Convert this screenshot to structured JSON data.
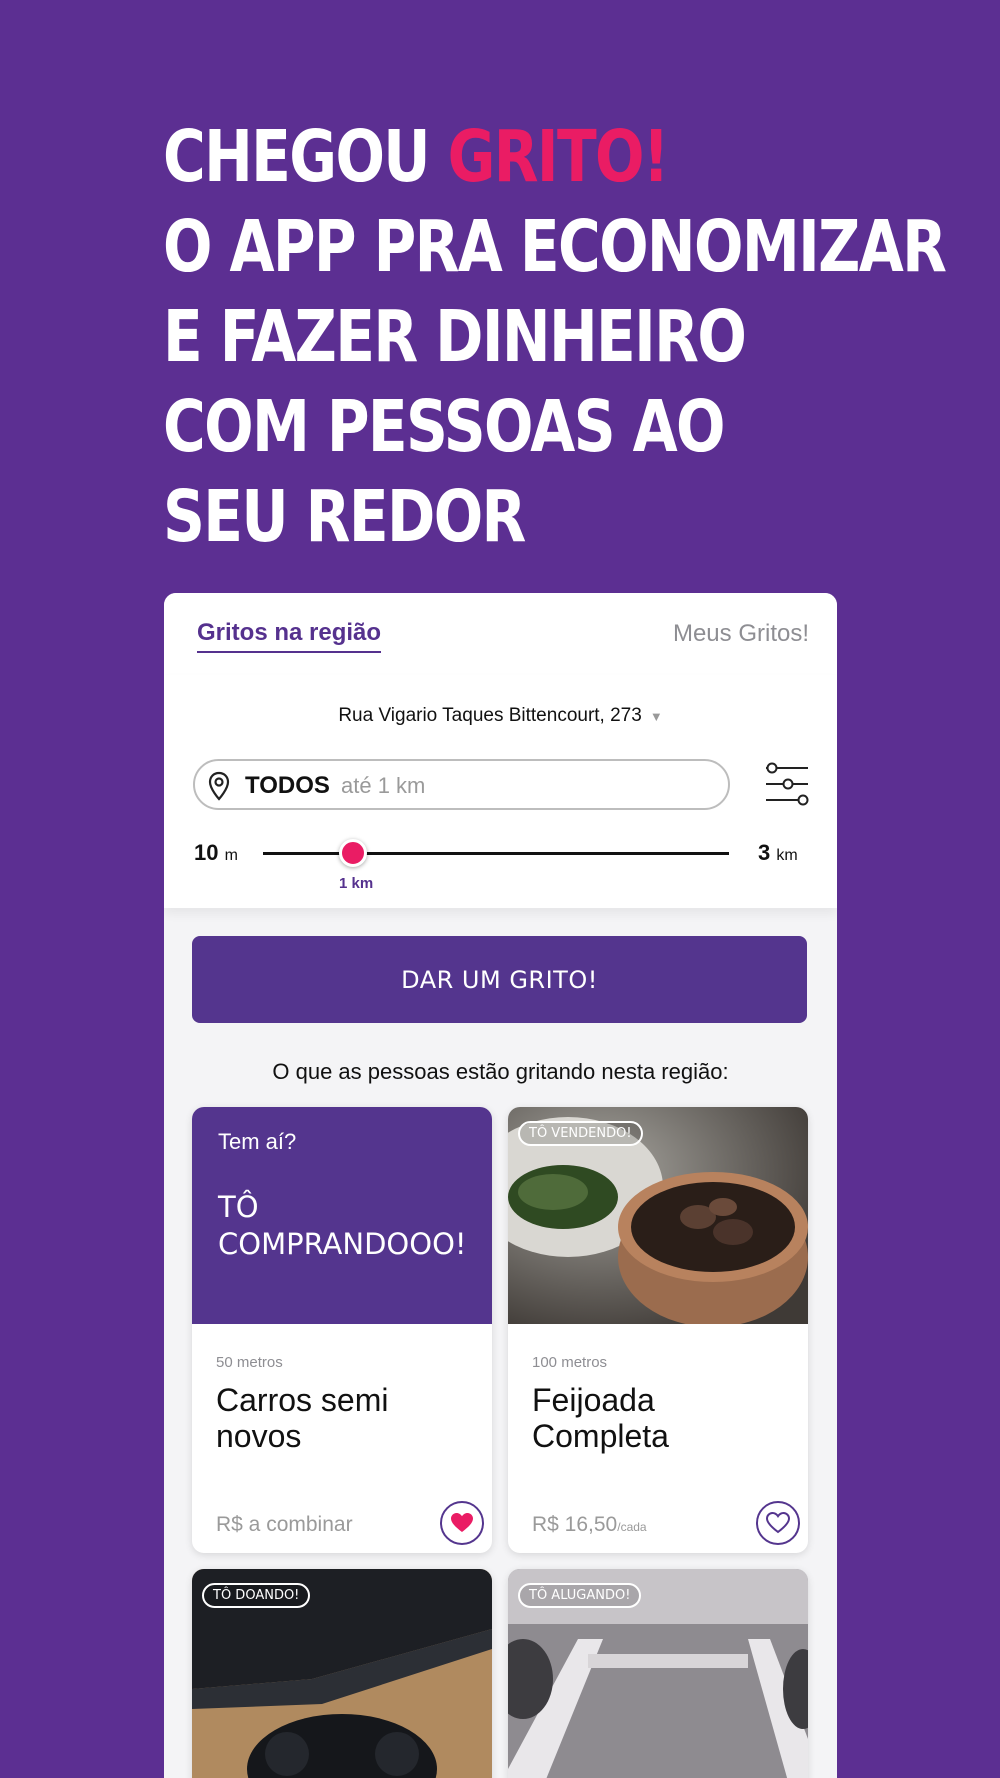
{
  "headline": {
    "line1_prefix": "CHEGOU ",
    "line1_accent": "GRITO!",
    "line2": "O APP PRA ECONOMIZAR",
    "line3": "E FAZER DINHEIRO",
    "line4": "COM PESSOAS AO",
    "line5": "SEU REDOR"
  },
  "colors": {
    "background": "#5c2f92",
    "accent": "#ea1c64",
    "brand": "#54358e"
  },
  "tabs": {
    "active": "Gritos na região",
    "inactive": "Meus Gritos!"
  },
  "filters": {
    "address": "Rua Vigario Taques Bittencourt, 273",
    "category": "TODOS",
    "range_text": "até 1 km",
    "slider": {
      "min_value": "10",
      "min_unit": "m",
      "max_value": "3",
      "max_unit": "km",
      "current_label": "1 km"
    }
  },
  "cta_label": "DAR UM GRITO!",
  "section_title": "O que as pessoas estão gritando nesta região:",
  "cards": [
    {
      "kicker": "Tem aí?",
      "big_text": "TÔ COMPRANDOOO!",
      "distance": "50 metros",
      "title": "Carros semi novos",
      "price": "R$ a combinar",
      "favorited": true
    },
    {
      "badge": "TÔ VENDENDO!",
      "image": "feijoada-photo",
      "distance": "100 metros",
      "title": "Feijoada Completa",
      "price": "R$ 16,50",
      "price_suffix": "/cada",
      "favorited": false
    },
    {
      "badge": "TÔ DOANDO!",
      "image": "game-console-photo"
    },
    {
      "badge": "TÔ ALUGANDO!",
      "image": "parking-spot-photo"
    }
  ]
}
